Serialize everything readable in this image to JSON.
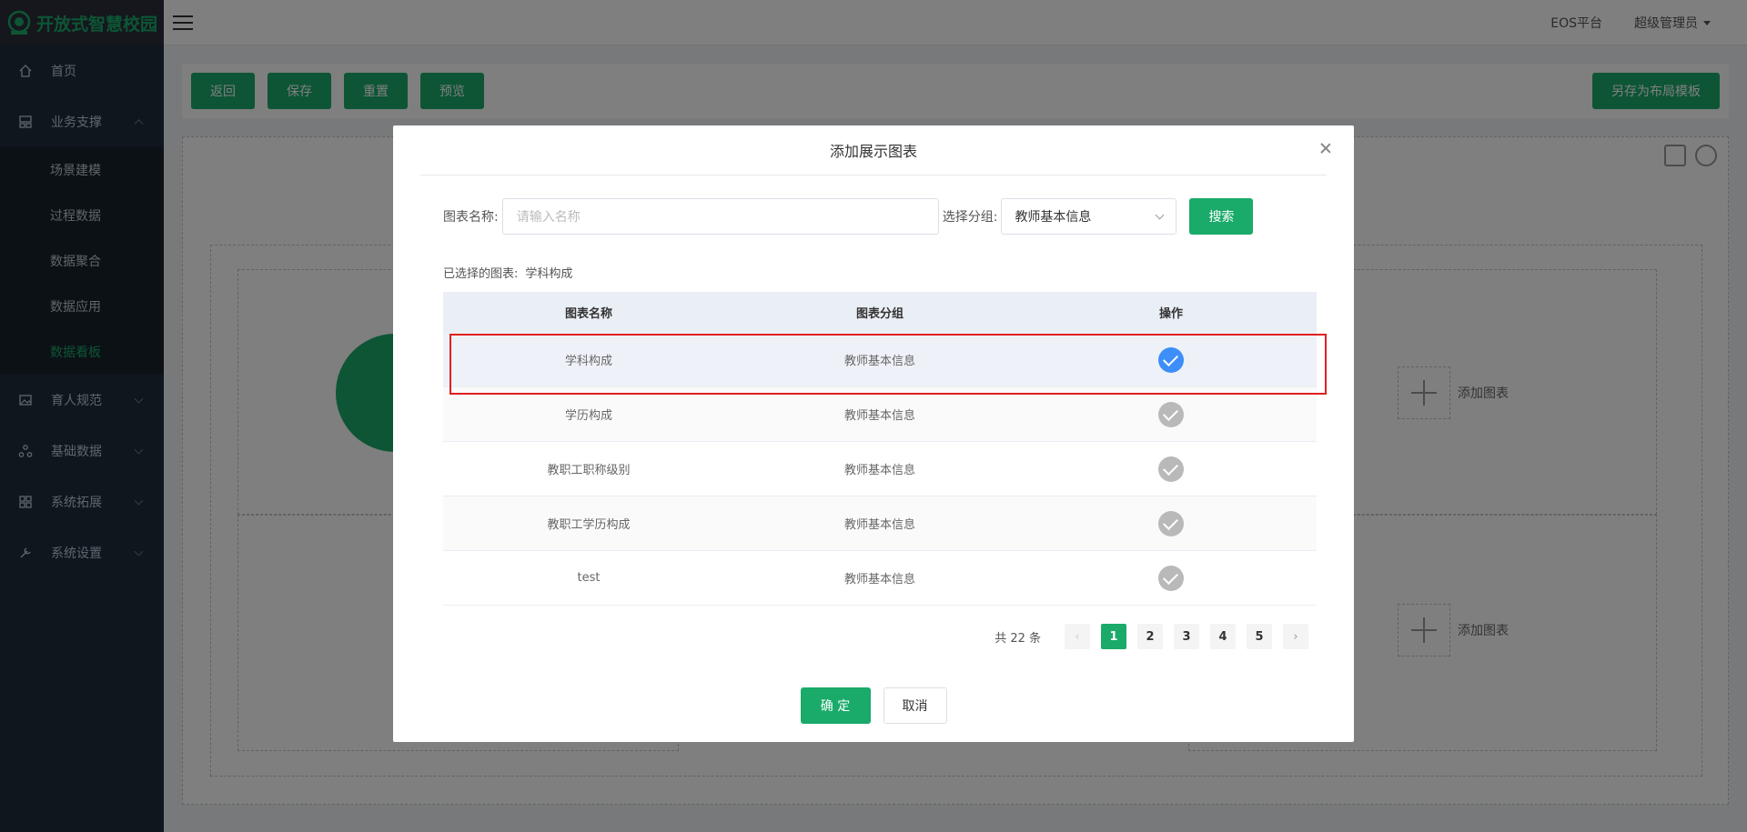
{
  "app": {
    "logo_text": "开放式智慧校园"
  },
  "sidebar": {
    "items": [
      {
        "label": "首页",
        "icon": "home-icon"
      },
      {
        "label": "业务支撑",
        "icon": "dashboard-icon",
        "expanded": true,
        "children": [
          {
            "label": "场景建模"
          },
          {
            "label": "过程数据"
          },
          {
            "label": "数据聚合"
          },
          {
            "label": "数据应用"
          },
          {
            "label": "数据看板",
            "active": true
          }
        ]
      },
      {
        "label": "育人规范",
        "icon": "image-icon"
      },
      {
        "label": "基础数据",
        "icon": "cluster-icon"
      },
      {
        "label": "系统拓展",
        "icon": "grid-icon"
      },
      {
        "label": "系统设置",
        "icon": "tools-icon"
      }
    ]
  },
  "topbar": {
    "platform": "EOS平台",
    "user": "超级管理员"
  },
  "toolbar": {
    "back": "返回",
    "save": "保存",
    "reset": "重置",
    "preview": "预览",
    "save_as_template": "另存为布局模板"
  },
  "canvas": {
    "add_chart_1": "添加图表",
    "add_chart_2": "添加图表"
  },
  "modal": {
    "title": "添加展示图表",
    "name_label": "图表名称:",
    "name_placeholder": "请输入名称",
    "group_label": "选择分组:",
    "group_value": "教师基本信息",
    "search": "搜索",
    "selected_label": "已选择的图表:",
    "selected_value": "学科构成",
    "columns": [
      "图表名称",
      "图表分组",
      "操作"
    ],
    "rows": [
      {
        "name": "学科构成",
        "group": "教师基本信息",
        "checked": true
      },
      {
        "name": "学历构成",
        "group": "教师基本信息",
        "checked": false
      },
      {
        "name": "教职工职称级别",
        "group": "教师基本信息",
        "checked": false
      },
      {
        "name": "教职工学历构成",
        "group": "教师基本信息",
        "checked": false
      },
      {
        "name": "test",
        "group": "教师基本信息",
        "checked": false
      }
    ],
    "pagination": {
      "total_text": "共 22 条",
      "pages": [
        "1",
        "2",
        "3",
        "4",
        "5"
      ],
      "current": "1",
      "prev": "‹",
      "next": "›"
    },
    "confirm": "确 定",
    "cancel": "取消"
  },
  "colors": {
    "accent": "#1aaa6a",
    "check_on": "#3d8ef8",
    "highlight_border": "#e02020",
    "sidebar_bg": "#1f2d3d"
  }
}
